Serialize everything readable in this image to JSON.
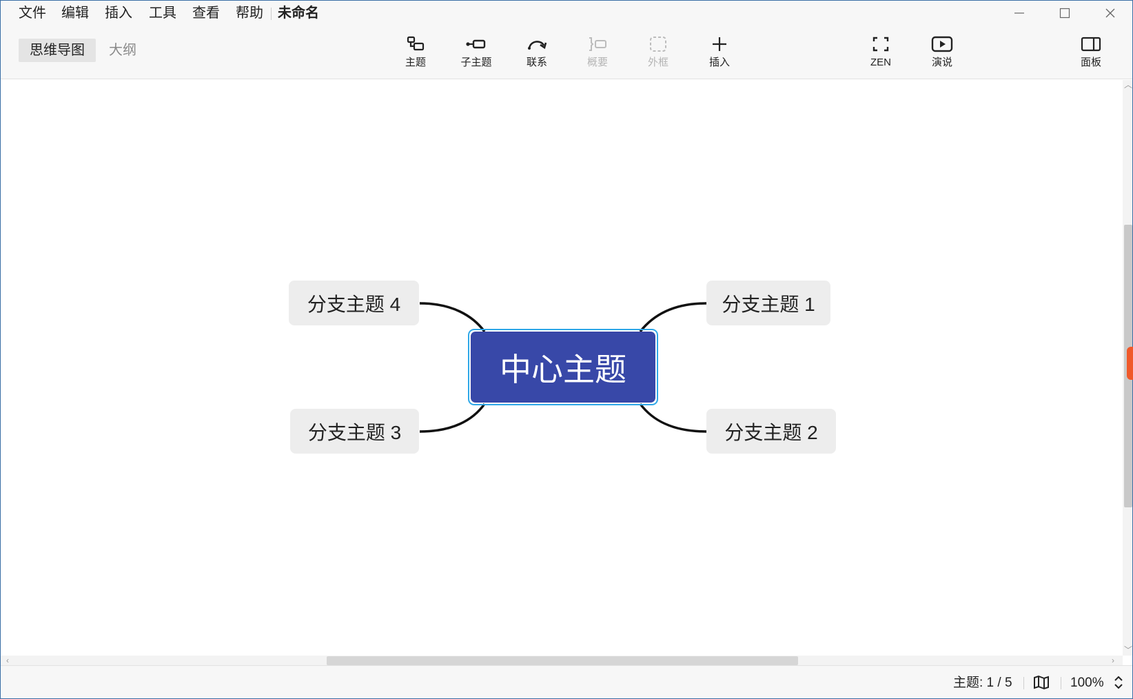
{
  "menubar": {
    "items": [
      {
        "label": "文件"
      },
      {
        "label": "编辑"
      },
      {
        "label": "插入"
      },
      {
        "label": "工具"
      },
      {
        "label": "查看"
      },
      {
        "label": "帮助"
      }
    ],
    "document_title": "未命名"
  },
  "view_tabs": {
    "mindmap": "思维导图",
    "outline": "大纲",
    "active": "mindmap"
  },
  "toolbar": {
    "topic": "主题",
    "subtopic": "子主题",
    "relationship": "联系",
    "summary": "概要",
    "boundary": "外框",
    "insert": "插入",
    "zen": "ZEN",
    "present": "演说",
    "panel": "面板"
  },
  "mindmap": {
    "central_topic": "中心主题",
    "branches": [
      {
        "label": "分支主题 1"
      },
      {
        "label": "分支主题 2"
      },
      {
        "label": "分支主题 3"
      },
      {
        "label": "分支主题 4"
      }
    ],
    "selected": "central_topic"
  },
  "statusbar": {
    "topic_count": "主题: 1 / 5",
    "zoom": "100%"
  },
  "colors": {
    "central_fill": "#3848a8",
    "selection": "#2fa8e8",
    "branch_fill": "#ededed",
    "connector": "#111111",
    "side_tab": "#f0592a"
  },
  "icons": {
    "window": [
      "minimize-icon",
      "maximize-icon",
      "close-icon"
    ],
    "toolbar": [
      "topic-icon",
      "subtopic-icon",
      "relationship-icon",
      "summary-icon",
      "boundary-icon",
      "plus-icon",
      "zen-icon",
      "play-icon",
      "panel-icon"
    ],
    "status": [
      "map-icon",
      "zoom-stepper-icon"
    ]
  }
}
